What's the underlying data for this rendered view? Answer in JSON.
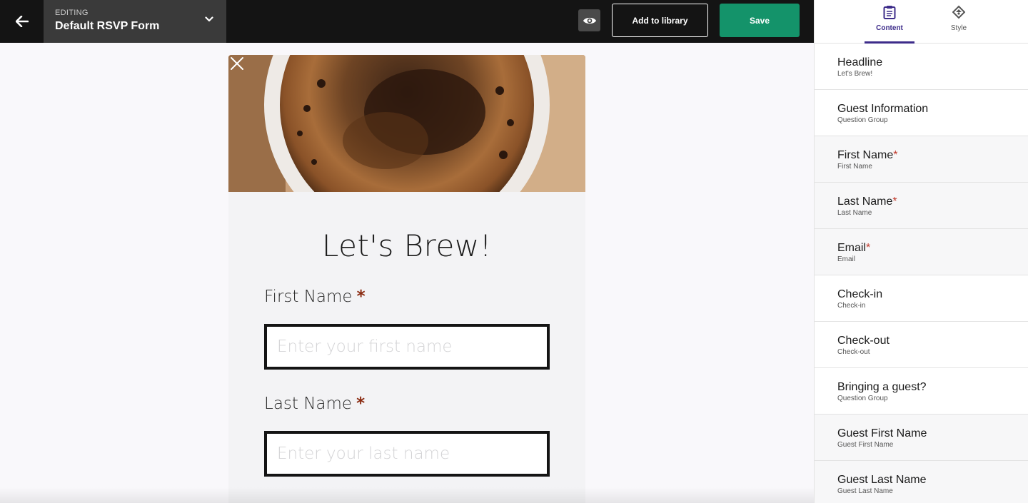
{
  "topbar": {
    "editing_label": "EDITING",
    "editing_title": "Default RSVP Form",
    "add_to_library_label": "Add to library",
    "save_label": "Save"
  },
  "form": {
    "headline": "Let's Brew!",
    "fields": [
      {
        "label": "First Name",
        "required_mark": "*",
        "placeholder": "Enter your first name"
      },
      {
        "label": "Last Name",
        "required_mark": "*",
        "placeholder": "Enter your last name"
      }
    ]
  },
  "panel": {
    "tabs": [
      {
        "label": "Content",
        "icon": "clipboard-icon",
        "active": true
      },
      {
        "label": "Style",
        "icon": "palette-icon",
        "active": false
      }
    ],
    "items": [
      {
        "title": "Headline",
        "required_mark": "",
        "subtitle": "Let's Brew!"
      },
      {
        "title": "Guest Information",
        "required_mark": "",
        "subtitle": "Question Group"
      },
      {
        "title": "First Name",
        "required_mark": "*",
        "subtitle": "First Name"
      },
      {
        "title": "Last Name",
        "required_mark": "*",
        "subtitle": "Last Name"
      },
      {
        "title": "Email",
        "required_mark": "*",
        "subtitle": "Email"
      },
      {
        "title": "Check-in",
        "required_mark": "",
        "subtitle": "Check-in"
      },
      {
        "title": "Check-out",
        "required_mark": "",
        "subtitle": "Check-out"
      },
      {
        "title": "Bringing a guest?",
        "required_mark": "",
        "subtitle": "Question Group"
      },
      {
        "title": "Guest First Name",
        "required_mark": "",
        "subtitle": "Guest First Name"
      },
      {
        "title": "Guest Last Name",
        "required_mark": "",
        "subtitle": "Guest Last Name"
      }
    ]
  },
  "colors": {
    "topbar": "#141414",
    "save_button": "#14936a",
    "accent_purple": "#3d2c8a",
    "required_star": "#c0392b"
  }
}
